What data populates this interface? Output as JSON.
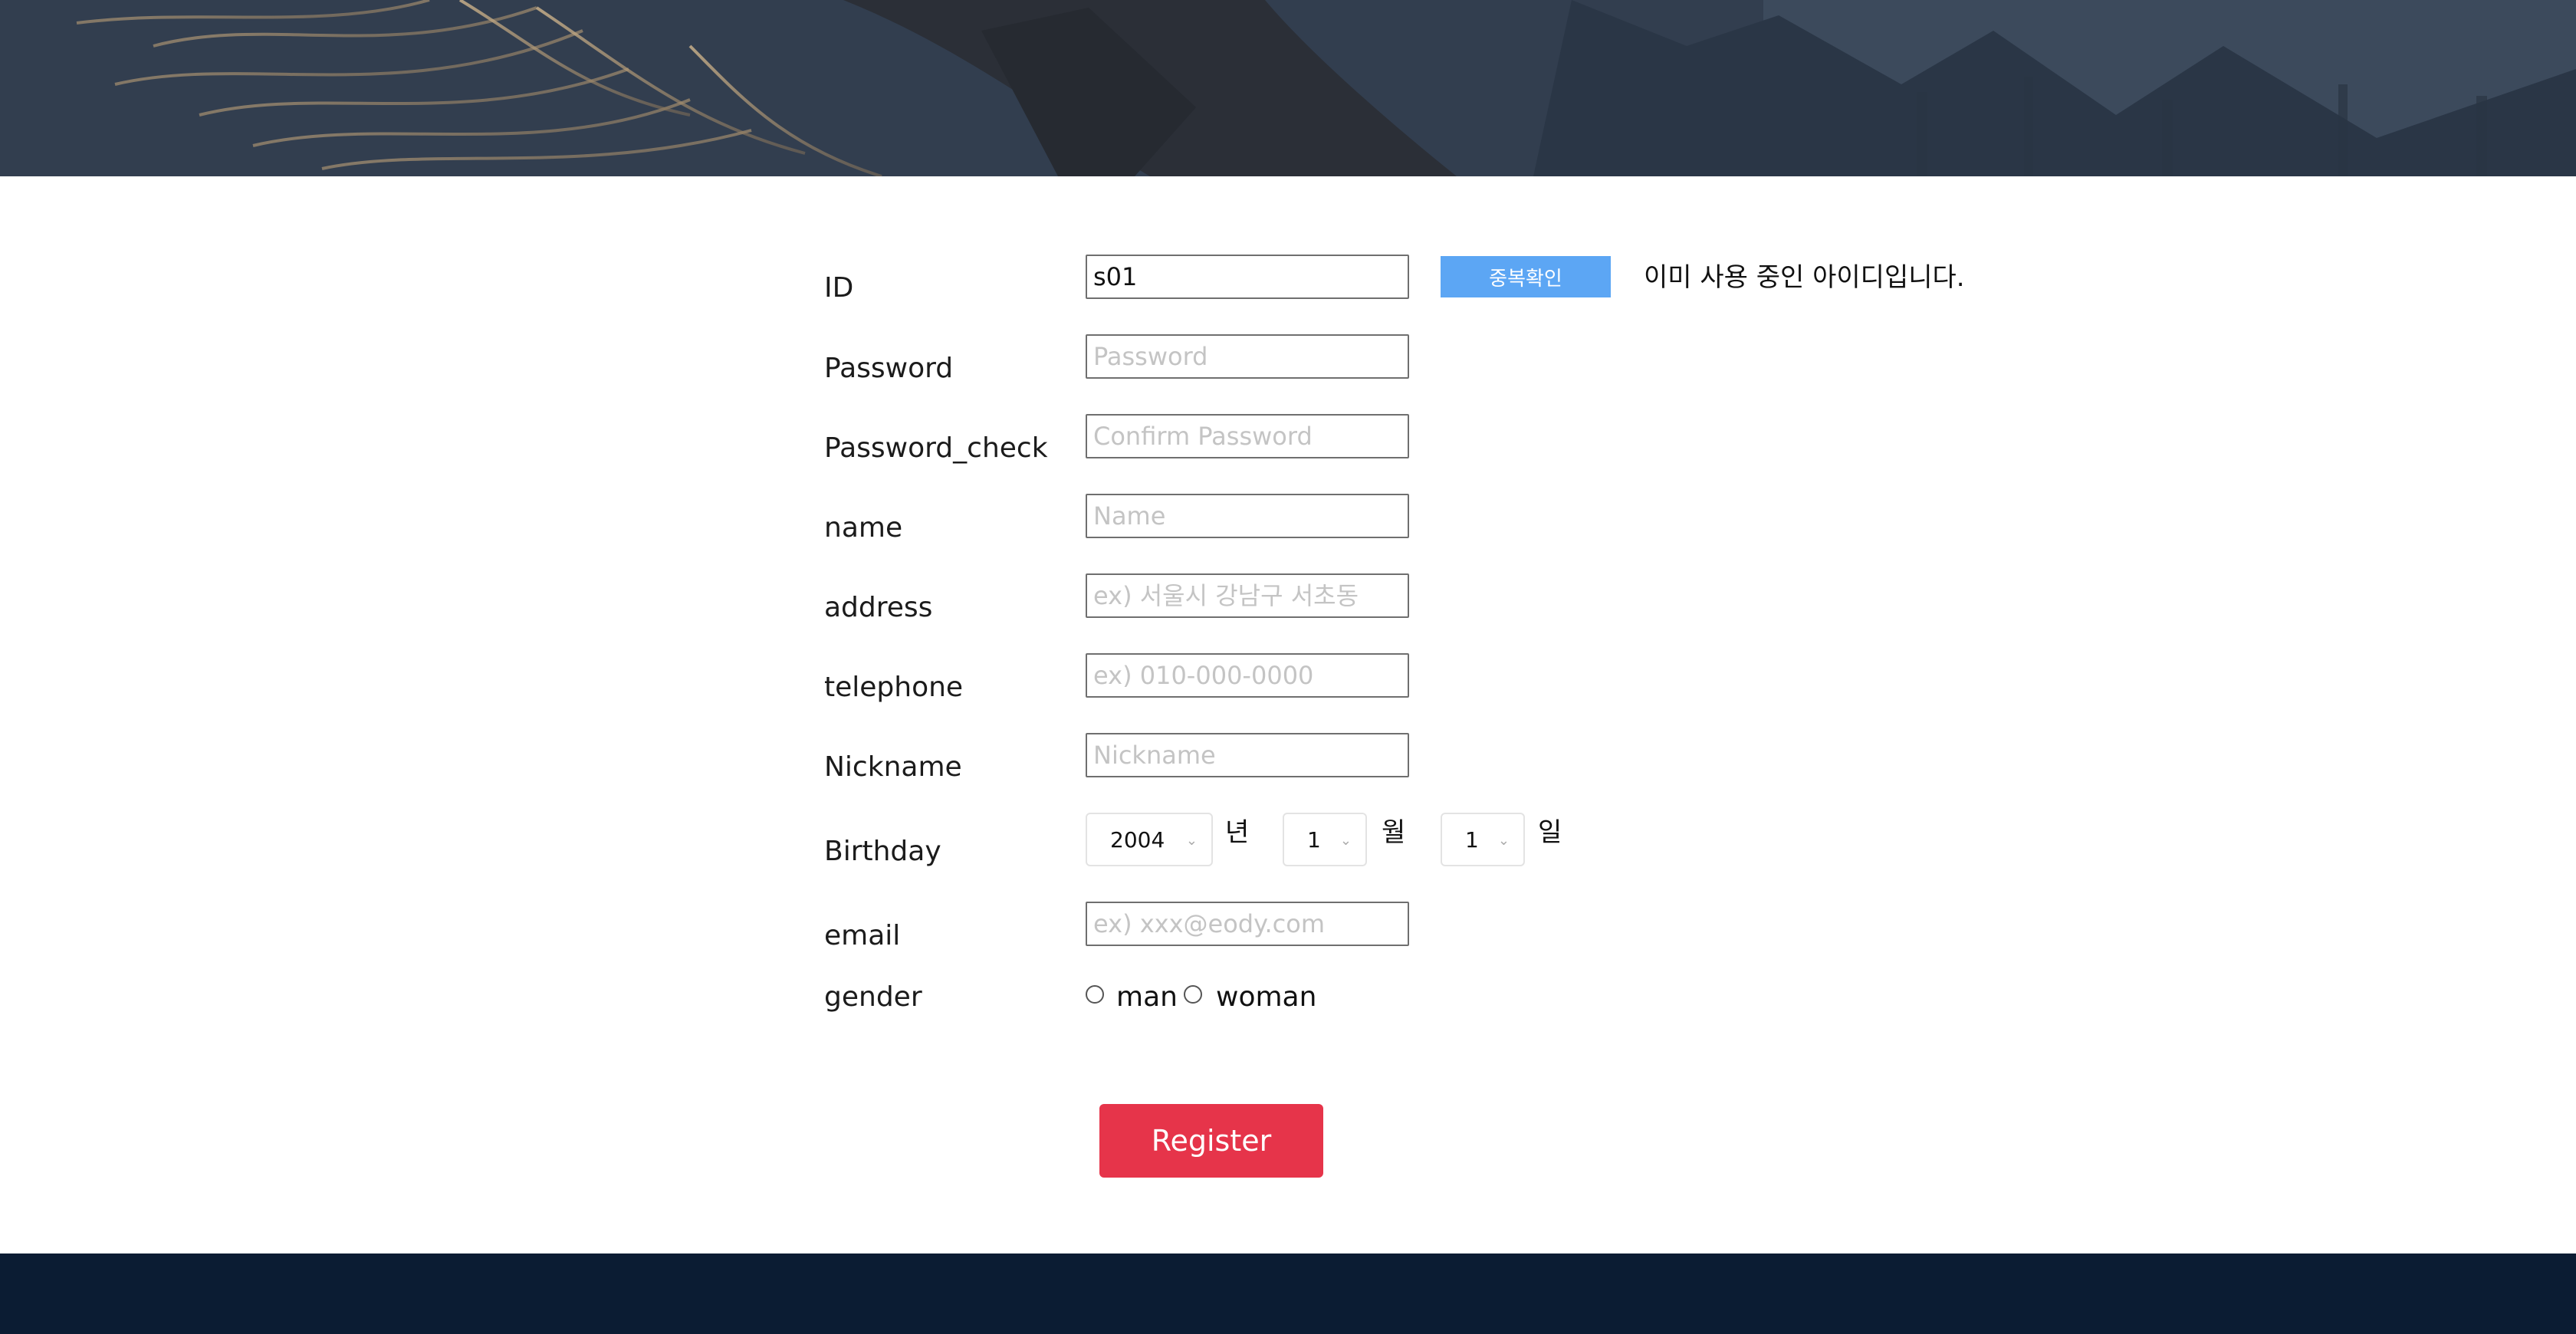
{
  "form": {
    "id": {
      "label": "ID",
      "value": "s01",
      "check_button": "중복확인",
      "message": "이미 사용 중인 아이디입니다."
    },
    "password": {
      "label": "Password",
      "placeholder": "Password"
    },
    "password_check": {
      "label": "Password_check",
      "placeholder": "Confirm Password"
    },
    "name": {
      "label": "name",
      "placeholder": "Name"
    },
    "address": {
      "label": "address",
      "placeholder": "ex) 서울시 강남구 서초동"
    },
    "telephone": {
      "label": "telephone",
      "placeholder": "ex) 010-000-0000"
    },
    "nickname": {
      "label": "Nickname",
      "placeholder": "Nickname"
    },
    "birthday": {
      "label": "Birthday",
      "year": "2004",
      "year_unit": "년",
      "month": "1",
      "month_unit": "월",
      "day": "1",
      "day_unit": "일"
    },
    "email": {
      "label": "email",
      "placeholder": "ex) xxx@eody.com"
    },
    "gender": {
      "label": "gender",
      "options": [
        "man",
        "woman"
      ]
    },
    "register_label": "Register"
  },
  "icons": {
    "select_chevron": "chevron-down-icon"
  },
  "colors": {
    "check_button": "#5ca6f4",
    "register_button": "#e6344a",
    "footer": "#0b1c33"
  }
}
